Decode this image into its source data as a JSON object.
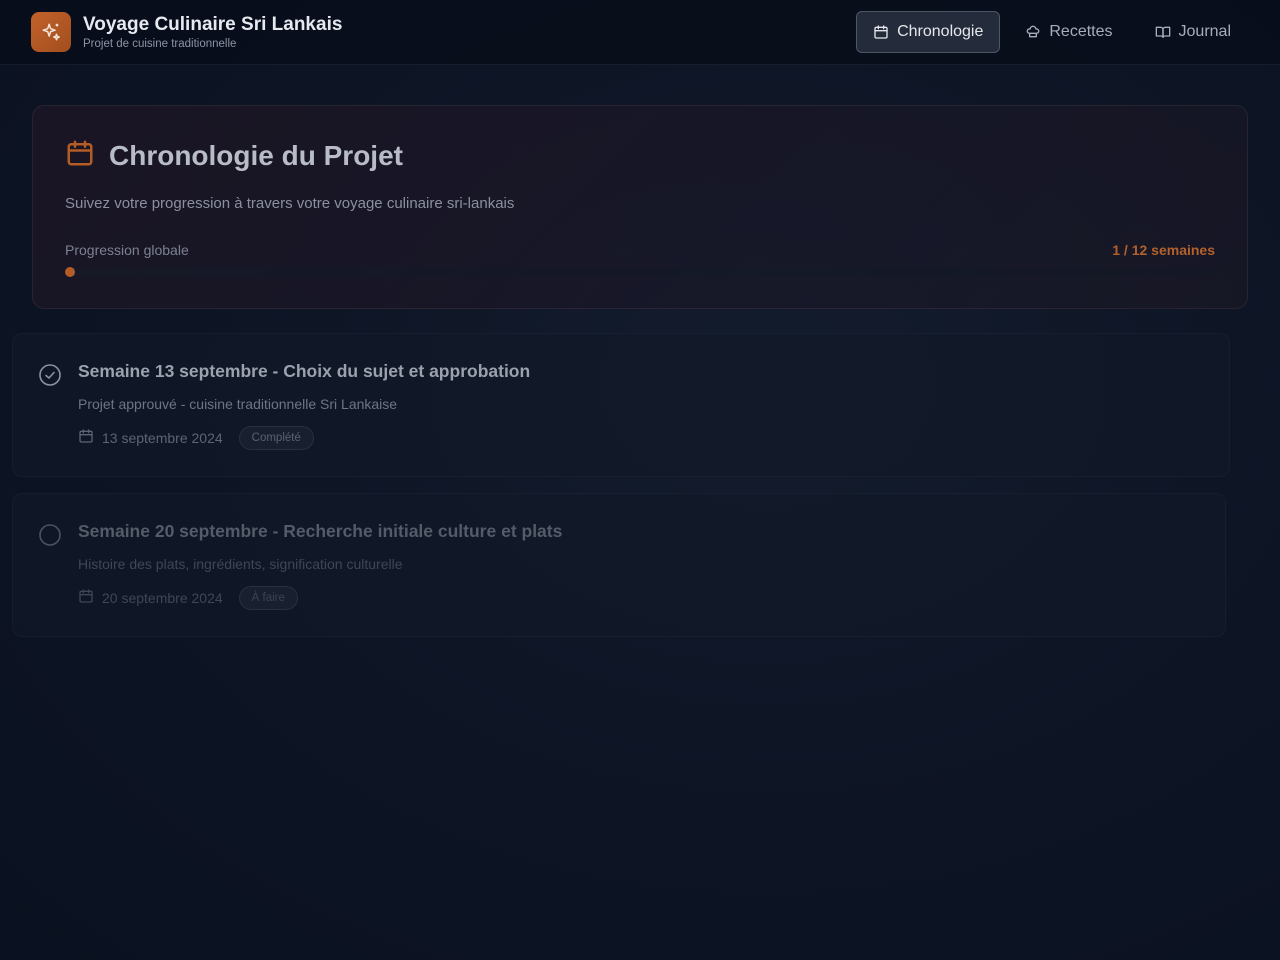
{
  "header": {
    "app_title": "Voyage Culinaire Sri Lankais",
    "app_subtitle": "Projet de cuisine traditionnelle",
    "logo_icon": "sparkles-icon",
    "nav": [
      {
        "label": "Chronologie",
        "icon": "calendar-icon",
        "active": true
      },
      {
        "label": "Recettes",
        "icon": "chef-hat-icon",
        "active": false
      },
      {
        "label": "Journal",
        "icon": "book-open-icon",
        "active": false
      }
    ]
  },
  "hero": {
    "icon": "calendar-icon",
    "title": "Chronologie du Projet",
    "description": "Suivez votre progression à travers votre voyage culinaire sri-lankais",
    "progress_label": "Progression globale",
    "progress_value": "1 / 12 semaines",
    "progress_fraction": 0.0
  },
  "timeline": [
    {
      "title": "Semaine 13 septembre - Choix du sujet et approbation",
      "description": "Projet approuvé - cuisine traditionnelle Sri Lankaise",
      "date": "13 septembre 2024",
      "status": "Complété",
      "status_icon": "check-circle-icon"
    },
    {
      "title": "Semaine 20 septembre - Recherche initiale culture et plats",
      "description": "Histoire des plats, ingrédients, signification culturelle",
      "date": "20 septembre 2024",
      "status": "À faire",
      "status_icon": "circle-icon"
    }
  ],
  "colors": {
    "accent": "#c2622a",
    "background": "#0d1424",
    "progress": "#b45c26"
  }
}
